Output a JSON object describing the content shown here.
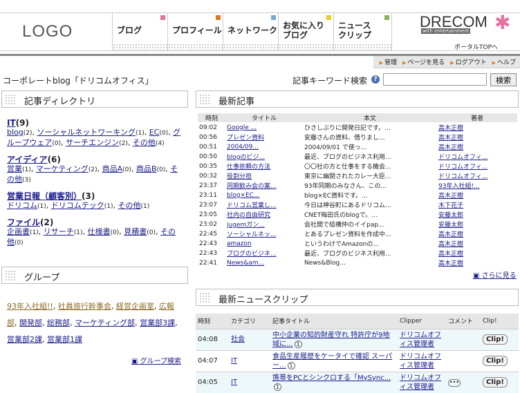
{
  "header": {
    "logo": "LOGO",
    "nav": [
      {
        "label": "ブログ",
        "color": "#e86fa0"
      },
      {
        "label": "プロフィール",
        "color": "#e07a20"
      },
      {
        "label": "ネットワーク",
        "color": "#7aaad0"
      },
      {
        "label": "お気に入り\nブログ",
        "color": "#e8d020"
      },
      {
        "label": "ニュース\nクリップ",
        "color": "#8ab060"
      }
    ],
    "brand": "DRECOM",
    "brand_tagline": "with entertainment",
    "portal_link": "ポータルTOPへ"
  },
  "util": {
    "admin": "管理",
    "view": "ページを見る",
    "logout": "ログアウト",
    "help": "ヘルプ"
  },
  "page_title": "コーポレートblog「ドリコムオフィス」",
  "search": {
    "label": "記事キーワード検索",
    "help": "?",
    "button": "検索",
    "value": ""
  },
  "directory": {
    "title": "記事ディレクトリ",
    "categories": [
      {
        "name": "IT",
        "count": "(9)",
        "items": [
          [
            "blog",
            "(2)"
          ],
          [
            "ソーシャルネットワーキング",
            "(1)"
          ],
          [
            "EC",
            "(0)"
          ],
          [
            "グループウェア",
            "(0)"
          ],
          [
            "サーチエンジン",
            "(2)"
          ],
          [
            "その他",
            "(4)"
          ]
        ]
      },
      {
        "name": "アイディア",
        "count": "(6)",
        "items": [
          [
            "営業",
            "(1)"
          ],
          [
            "マーケティング",
            "(2)"
          ],
          [
            "商品A",
            "(0)"
          ],
          [
            "商品B",
            "(0)"
          ],
          [
            "その他",
            "(3)"
          ]
        ]
      },
      {
        "name": "営業日報（顧客別）",
        "count": "(3)",
        "items": [
          [
            "ドリコム",
            "(1)"
          ],
          [
            "ドリコムテック",
            "(1)"
          ],
          [
            "その他",
            "(1)"
          ]
        ]
      },
      {
        "name": "ファイル",
        "count": "(2)",
        "items": [
          [
            "企画書",
            "(1)"
          ],
          [
            "リサーチ",
            "(1)"
          ],
          [
            "仕様書",
            "(0)"
          ],
          [
            "見積書",
            "(0)"
          ],
          [
            "その他",
            "(0)"
          ]
        ]
      }
    ]
  },
  "groups": {
    "title": "グループ",
    "items": [
      "93年入社組!!",
      "社員旅行幹事会",
      "経営企画室",
      "広報部",
      "開発部",
      "総務部",
      "マーケティング部",
      "営業部3課",
      "営業部2課",
      "営業部1課"
    ],
    "search_link": "グループ検索"
  },
  "articles": {
    "title": "最新記事",
    "headers": [
      "時刻",
      "タイトル",
      "本文",
      "著者"
    ],
    "rows": [
      [
        "09:02",
        "Google ...",
        "ひさしぶりに開発日記です。...",
        "高木正樹"
      ],
      [
        "00:56",
        "プレゼン資料",
        "安藤さんの資料、借りまし...",
        "高木正樹"
      ],
      [
        "00:51",
        "2004/09...",
        "2004/09/01 で使っ...",
        "高木正樹"
      ],
      [
        "00:50",
        "blogのビジ...",
        "最近、ブログのビジネス利用...",
        "ドリコムオフィ..."
      ],
      [
        "00:35",
        "仕事依頼の方法",
        "〇〇社の方と仕事をする機会...",
        "ドリコムオフィ..."
      ],
      [
        "00:32",
        "役割分担",
        "東京に幽閉されたカレー大臣...",
        "ドリコムオフィ..."
      ],
      [
        "23:37",
        "同期飲み会の案...",
        "93年同期のみなさん、この...",
        "93年入社組!..."
      ],
      [
        "23:11",
        "blog×EC...",
        "blog×EC資料です。...",
        "高木正樹"
      ],
      [
        "23:07",
        "ドリコム営業し...",
        "今日は神谷町にあるドリコム...",
        "木下花子"
      ],
      [
        "23:05",
        "社内の自由研究",
        "CNET梅田氏のblogで。...",
        "安藤太郎"
      ],
      [
        "23:02",
        "jugemガン...",
        "会社間で結構仲のイイpap...",
        "安藤太郎"
      ],
      [
        "22:45",
        "ソーシャルネッ...",
        "とあるプレゼン資料を作成中...",
        "高木正樹"
      ],
      [
        "22:43",
        "amazon",
        "というわけでAmazonの...",
        "高木正樹"
      ],
      [
        "22:43",
        "ブログのビジネ...",
        "最近、ブログのビジネス利用...",
        "高木正樹"
      ],
      [
        "22:41",
        "News&am...",
        "News&Blog...",
        "高木正樹"
      ]
    ],
    "more_link": "さらに見る"
  },
  "clips": {
    "title": "最新ニュースクリップ",
    "headers": [
      "時刻",
      "カテゴリ",
      "記事タイトル",
      "Clipper",
      "コメント",
      "Clip!"
    ],
    "rows": [
      {
        "time": "04:08",
        "category": "社会",
        "title": "中小企業の知的財産守れ 特許庁が9地域に...",
        "num": "1",
        "clipper": "ドリコムオフィス管理者",
        "comment": "",
        "clip": "Clip!"
      },
      {
        "time": "04:07",
        "category": "IT",
        "title": "食品生産履歴をケータイで確認 スーパー...",
        "num": "1",
        "clipper": "ドリコムオフィス管理者",
        "comment": "",
        "clip": "Clip!"
      },
      {
        "time": "04:05",
        "category": "IT",
        "title": "携帯をPCとシンクロする「MySync...",
        "num": "1",
        "clipper": "ドリコムオフィス管理者",
        "comment": "•••",
        "clip": "Clip!"
      }
    ]
  }
}
